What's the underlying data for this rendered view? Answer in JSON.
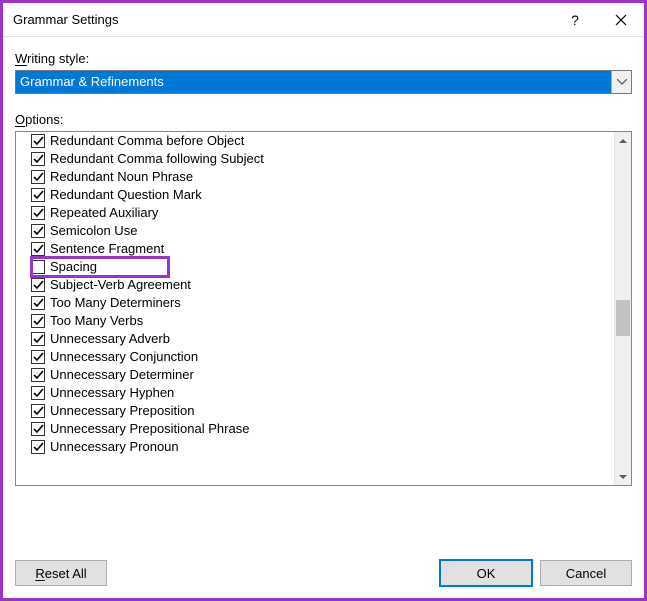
{
  "window": {
    "title": "Grammar Settings",
    "help_tooltip": "?",
    "close_tooltip": "Close"
  },
  "labels": {
    "writing_style_pre": "W",
    "writing_style_rest": "riting style:",
    "options_pre": "O",
    "options_rest": "ptions:"
  },
  "dropdown": {
    "selected": "Grammar & Refinements"
  },
  "options": [
    {
      "text": "Redundant Comma before Object",
      "checked": true
    },
    {
      "text": "Redundant Comma following Subject",
      "checked": true
    },
    {
      "text": "Redundant Noun Phrase",
      "checked": true
    },
    {
      "text": "Redundant Question Mark",
      "checked": true
    },
    {
      "text": "Repeated Auxiliary",
      "checked": true
    },
    {
      "text": "Semicolon Use",
      "checked": true
    },
    {
      "text": "Sentence Fragment",
      "checked": true
    },
    {
      "text": "Spacing",
      "checked": false
    },
    {
      "text": "Subject-Verb Agreement",
      "checked": true
    },
    {
      "text": "Too Many Determiners",
      "checked": true
    },
    {
      "text": "Too Many Verbs",
      "checked": true
    },
    {
      "text": "Unnecessary Adverb",
      "checked": true
    },
    {
      "text": "Unnecessary Conjunction",
      "checked": true
    },
    {
      "text": "Unnecessary Determiner",
      "checked": true
    },
    {
      "text": "Unnecessary Hyphen",
      "checked": true
    },
    {
      "text": "Unnecessary Preposition",
      "checked": true
    },
    {
      "text": "Unnecessary Prepositional Phrase",
      "checked": true
    },
    {
      "text": "Unnecessary Pronoun",
      "checked": true
    }
  ],
  "highlighted_index": 7,
  "buttons": {
    "reset_pre": "R",
    "reset_rest": "eset All",
    "ok": "OK",
    "cancel": "Cancel"
  }
}
